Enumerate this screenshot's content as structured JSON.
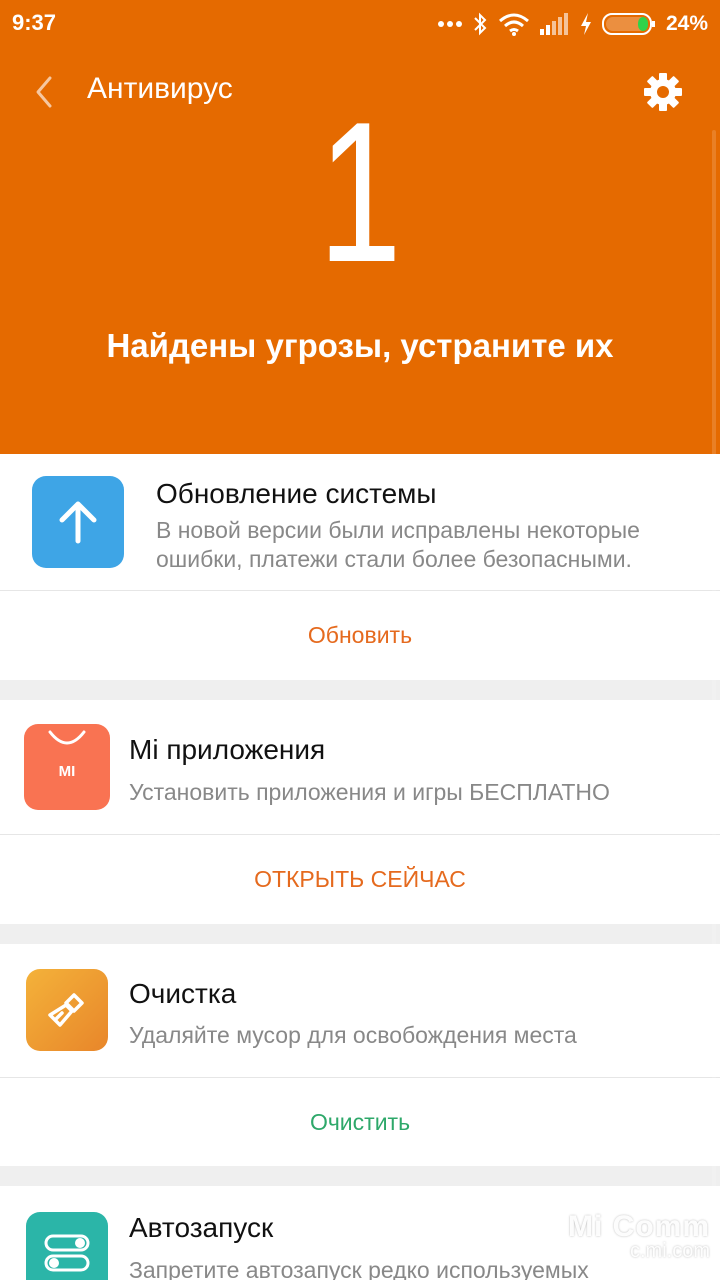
{
  "status_bar": {
    "time": "9:37",
    "battery_percent": "24%",
    "icons": [
      "more-dots-icon",
      "bluetooth-icon",
      "wifi-icon",
      "signal-icon",
      "charging-icon",
      "battery-icon"
    ]
  },
  "header": {
    "title": "Антивирус",
    "back_icon": "chevron-left-icon",
    "settings_icon": "gear-icon"
  },
  "scan_result": {
    "threat_count": "1",
    "message": "Найдены угрозы, устраните их"
  },
  "cards": [
    {
      "title": "Обновление системы",
      "description_line1": "В новой версии были исправлены некоторые",
      "description_line2": "ошибки, платежи стали более безопасными.",
      "action": "Обновить",
      "icon": "arrow-up-icon",
      "icon_color": "#3ea5e6",
      "action_color": "#e56a1e"
    },
    {
      "title": "Mi приложения",
      "description_line1": "Установить приложения и игры БЕСПЛАТНО",
      "action": "ОТКРЫТЬ СЕЙЧАС",
      "icon": "mi-store-bag-icon",
      "icon_color": "#f97352",
      "icon_text": "MI",
      "action_color": "#e56a1e"
    },
    {
      "title": "Очистка",
      "description_line1": "Удаляйте мусор для освобождения места",
      "action": "Очистить",
      "icon": "broom-icon",
      "icon_color": "#f0a030",
      "action_color": "#2ea86a"
    },
    {
      "title": "Автозапуск",
      "description_line1": "Запретите автозапуск редко используемых",
      "icon": "toggle-switches-icon",
      "icon_color": "#2bb5a8"
    }
  ],
  "watermark": {
    "line1": "Mi Comm",
    "line2": "c.mi.com"
  },
  "colors": {
    "accent": "#e56a00",
    "background": "#efefef"
  }
}
